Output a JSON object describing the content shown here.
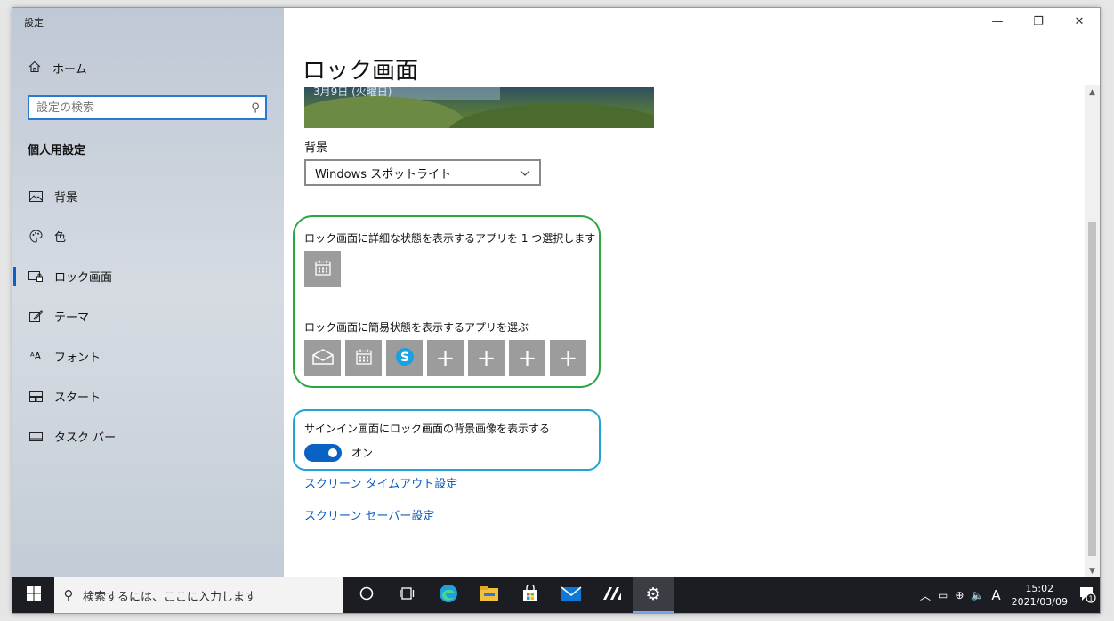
{
  "window": {
    "app_title": "設定",
    "minimize": "—",
    "restore": "❐",
    "close": "✕"
  },
  "sidebar": {
    "home_label": "ホーム",
    "search_placeholder": "設定の検索",
    "section_title": "個人用設定",
    "items": [
      {
        "label": "背景",
        "icon": "image-icon",
        "active": false
      },
      {
        "label": "色",
        "icon": "palette-icon",
        "active": false
      },
      {
        "label": "ロック画面",
        "icon": "lock-screen-icon",
        "active": true
      },
      {
        "label": "テーマ",
        "icon": "theme-icon",
        "active": false
      },
      {
        "label": "フォント",
        "icon": "font-icon",
        "active": false
      },
      {
        "label": "スタート",
        "icon": "start-icon",
        "active": false
      },
      {
        "label": "タスク バー",
        "icon": "taskbar-icon",
        "active": false
      }
    ]
  },
  "main": {
    "page_title": "ロック画面",
    "preview_date": "3月9日 (火曜日)",
    "background_label": "背景",
    "background_value": "Windows スポットライト",
    "detailed_status_label": "ロック画面に詳細な状態を表示するアプリを 1 つ選択します",
    "quick_status_label": "ロック画面に簡易状態を表示するアプリを選ぶ",
    "quick_tiles": [
      {
        "icon": "mail-icon"
      },
      {
        "icon": "calendar-icon"
      },
      {
        "icon": "skype-icon"
      },
      {
        "icon": "plus-icon"
      },
      {
        "icon": "plus-icon"
      },
      {
        "icon": "plus-icon"
      },
      {
        "icon": "plus-icon"
      }
    ],
    "signin_bg_label": "サインイン画面にロック画面の背景画像を表示する",
    "signin_toggle_state": "オン",
    "link_timeout": "スクリーン タイムアウト設定",
    "link_screensaver": "スクリーン セーバー設定"
  },
  "taskbar": {
    "search_placeholder": "検索するには、ここに入力します",
    "ime": "A",
    "time": "15:02",
    "date": "2021/03/09",
    "notification_count": "1"
  },
  "colors": {
    "accent": "#0a62c4",
    "green_highlight": "#2aa640",
    "blue_highlight": "#20a3d6",
    "tile_gray": "#9c9c9c"
  }
}
